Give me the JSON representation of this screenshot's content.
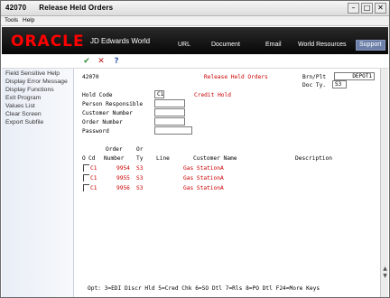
{
  "window": {
    "number": "42070",
    "title": "Release Held Orders"
  },
  "window_controls": {
    "minimize": "–",
    "maximize": "□",
    "close": "✕"
  },
  "menubar": {
    "tools": "Tools",
    "help": "Help"
  },
  "banner": {
    "logo": "ORACLE",
    "product": "JD Edwards World",
    "links": [
      "URL",
      "Document",
      "Email",
      "World Resources",
      "Support"
    ]
  },
  "toolbar": {
    "ok": "✔",
    "cancel": "✕",
    "help": "?"
  },
  "sidebar": {
    "items": [
      "Field Sensitive Help",
      "Display Error Message",
      "Display Functions",
      "Exit Program",
      "Values List",
      "Clear Screen",
      "Export Subfile"
    ]
  },
  "form": {
    "program_id": "42070",
    "form_title": "Release Held Orders",
    "brn_plt_label": "Brn/Plt",
    "brn_plt_value": "DEPOT1",
    "doc_ty_label": "Doc Ty.",
    "doc_ty_value": "S3",
    "hold_code_label": "Hold Code",
    "hold_code_value": "C1",
    "hold_code_desc": "Credit Hold",
    "person_responsible_label": "Person Responsible",
    "customer_number_label": "Customer Number",
    "order_number_label": "Order Number",
    "password_label": "Password"
  },
  "grid": {
    "headers": {
      "o": "O",
      "cd": "Cd",
      "order_top": "Order",
      "order_bottom": "Number",
      "or_top": "Or",
      "or_bottom": "Ty",
      "line": "Line",
      "customer": "Customer Name",
      "description": "Description"
    },
    "rows": [
      {
        "cd": "C1",
        "order": "9954",
        "ty": "S3",
        "line": "",
        "customer": "Gas StationA",
        "description": ""
      },
      {
        "cd": "C1",
        "order": "9955",
        "ty": "S3",
        "line": "",
        "customer": "Gas StationA",
        "description": ""
      },
      {
        "cd": "C1",
        "order": "9956",
        "ty": "S3",
        "line": "",
        "customer": "Gas StationA",
        "description": ""
      }
    ]
  },
  "footer": {
    "options": "Opt:  3=EDI Discr Hld   5=Cred Chk   6=SO Dtl   7=Rls   8=PO Dtl   F24=More Keys"
  },
  "scrollbar": {
    "up": "▲",
    "down": "▼"
  }
}
